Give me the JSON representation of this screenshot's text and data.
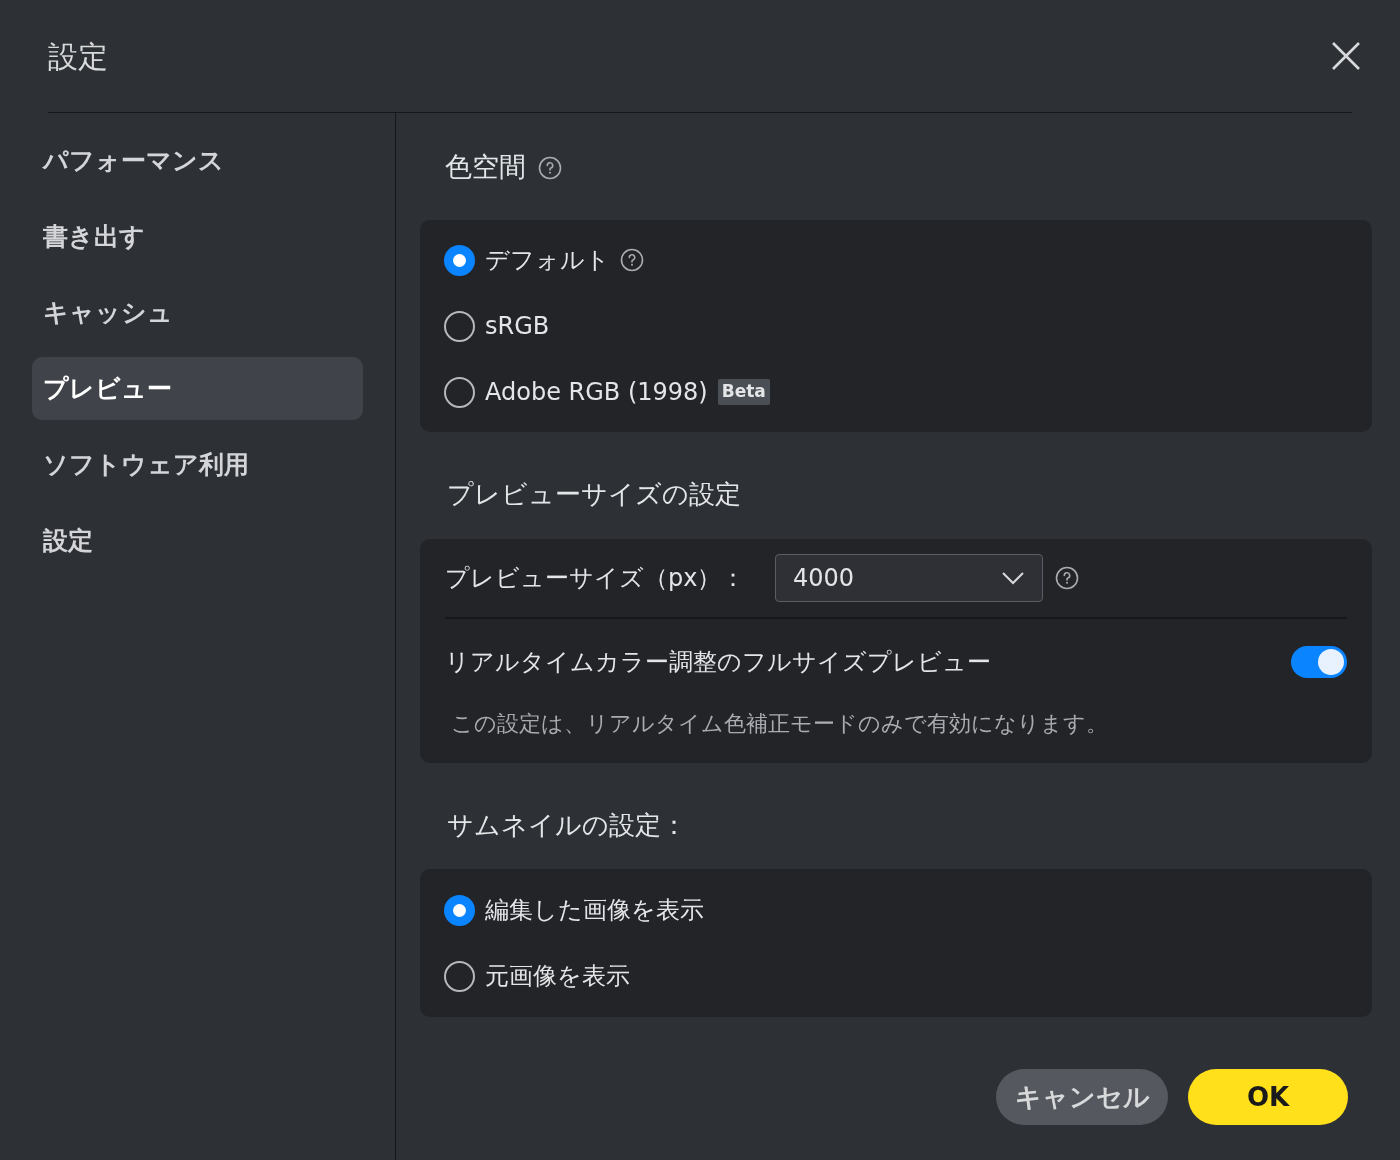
{
  "dialog": {
    "title": "設定"
  },
  "sidebar": {
    "items": [
      {
        "label": "パフォーマンス",
        "selected": false
      },
      {
        "label": "書き出す",
        "selected": false
      },
      {
        "label": "キャッシュ",
        "selected": false
      },
      {
        "label": "プレビュー",
        "selected": true
      },
      {
        "label": "ソフトウェア利用",
        "selected": false
      },
      {
        "label": "設定",
        "selected": false
      }
    ]
  },
  "color_space": {
    "heading": "色空間",
    "options": [
      {
        "label": "デフォルト",
        "selected": true,
        "help": true
      },
      {
        "label": "sRGB",
        "selected": false,
        "help": false
      },
      {
        "label": "Adobe RGB (1998)",
        "selected": false,
        "help": false,
        "badge": "Beta"
      }
    ]
  },
  "preview_size": {
    "heading": "プレビューサイズの設定",
    "size_label": "プレビューサイズ（px）：",
    "size_value": "4000",
    "toggle_label": "リアルタイムカラー調整のフルサイズプレビュー",
    "toggle_on": true,
    "note": "この設定は、リアルタイム色補正モードのみで有効になります。"
  },
  "thumbnail": {
    "heading": "サムネイルの設定：",
    "options": [
      {
        "label": "編集した画像を表示",
        "selected": true
      },
      {
        "label": "元画像を表示",
        "selected": false
      }
    ]
  },
  "buttons": {
    "cancel": "キャンセル",
    "ok": "OK"
  }
}
